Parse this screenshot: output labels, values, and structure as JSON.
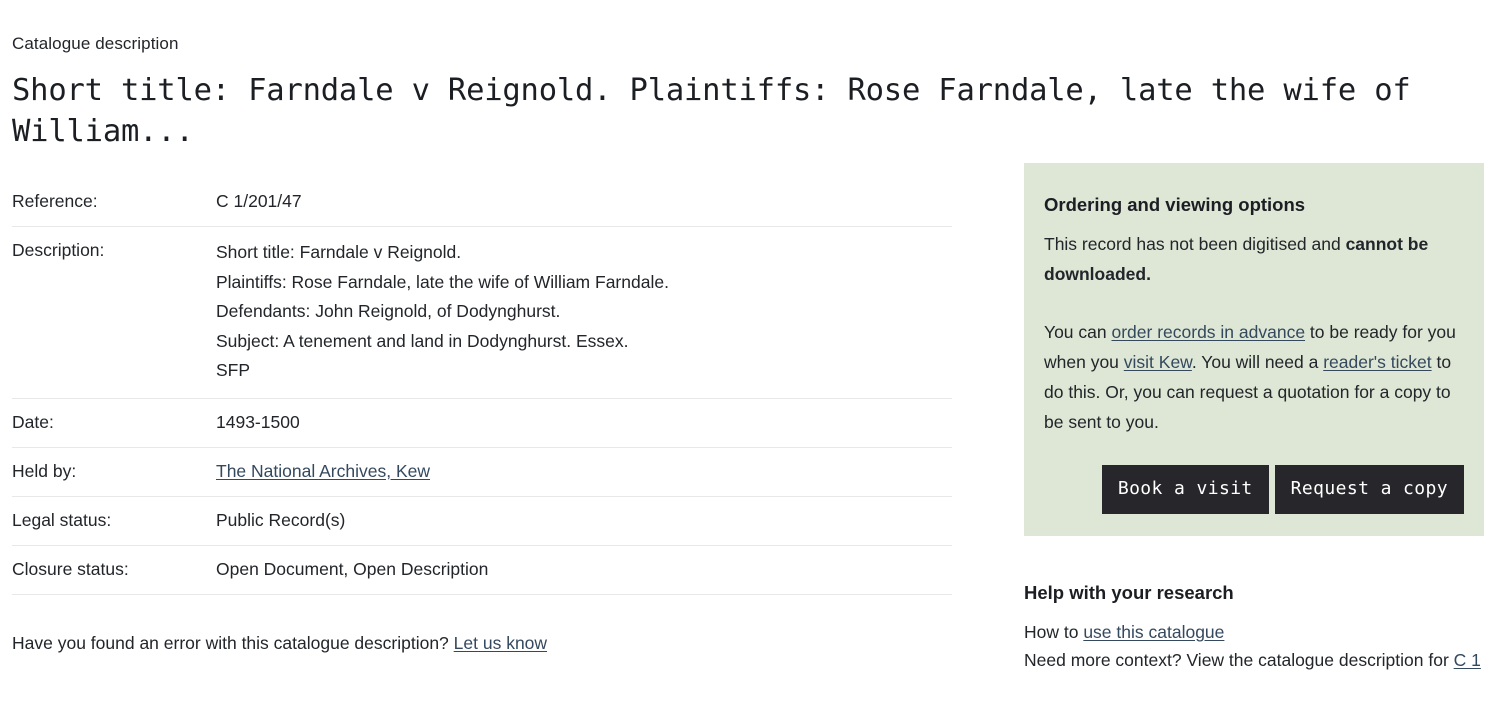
{
  "page": {
    "eyebrow": "Catalogue description",
    "title": "Short title: Farndale v Reignold. Plaintiffs: Rose Farndale, late the wife of William..."
  },
  "details": {
    "rows": [
      {
        "label": "Reference:",
        "value": "C 1/201/47",
        "type": "text"
      },
      {
        "label": "Description:",
        "type": "multiline",
        "lines": [
          "Short title: Farndale v Reignold.",
          "Plaintiffs: Rose Farndale, late the wife of William Farndale.",
          "Defendants: John Reignold, of Dodynghurst.",
          "Subject: A tenement and land in Dodynghurst. Essex.",
          "SFP"
        ]
      },
      {
        "label": "Date:",
        "value": "1493-1500",
        "type": "text"
      },
      {
        "label": "Held by:",
        "value": "The National Archives, Kew",
        "type": "link"
      },
      {
        "label": "Legal status:",
        "value": "Public Record(s)",
        "type": "text"
      },
      {
        "label": "Closure status:",
        "value": "Open Document, Open Description",
        "type": "text"
      }
    ]
  },
  "error_note": {
    "text": "Have you found an error with this catalogue description? ",
    "link_label": "Let us know"
  },
  "ordering_panel": {
    "heading": "Ordering and viewing options",
    "digitised_text_part1": "This record has not been digitised and ",
    "digitised_text_bold": "cannot be downloaded.",
    "order_text_part1": "You can ",
    "order_link_1": "order records in advance",
    "order_text_part2": " to be ready for you when you ",
    "order_link_2": "visit Kew",
    "order_text_part3": ". You will need a ",
    "order_link_3": "reader's ticket",
    "order_text_part4": " to do this. Or, you can request a quotation for a copy to be sent to you.",
    "book_visit_label": "Book a visit",
    "request_copy_label": "Request a copy",
    "background_color": "#dee6d5",
    "button_color": "#26262b"
  },
  "help_panel": {
    "heading": "Help with your research",
    "line1_prefix": "How to ",
    "line1_link": "use this catalogue",
    "line2_prefix": "Need more context? View the catalogue description for ",
    "line2_link": "C 1"
  },
  "colors": {
    "link": "#34495e",
    "text": "#22252a",
    "divider": "#e8e8e8"
  }
}
